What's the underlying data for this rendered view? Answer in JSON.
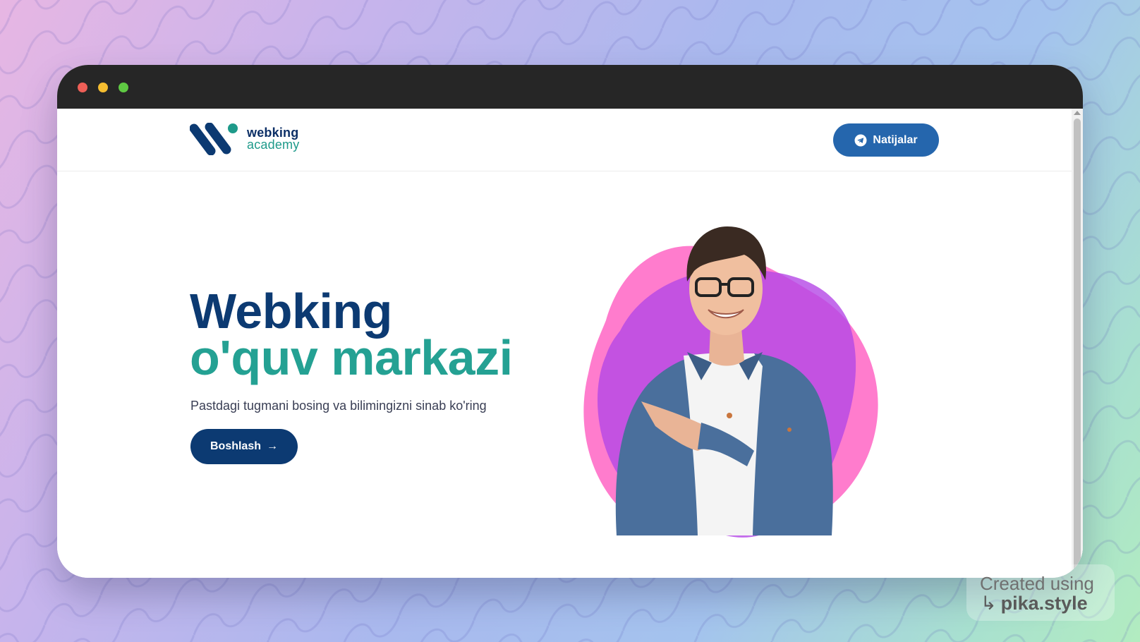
{
  "brand": {
    "logo_line1": "webking",
    "logo_line2": "academy",
    "primary_color": "#0c3a72",
    "accent_color": "#24a193",
    "button_color": "#2566ad"
  },
  "window": {
    "controls": [
      "close",
      "minimize",
      "maximize"
    ]
  },
  "header": {
    "results_button_label": "Natijalar",
    "results_button_icon": "telegram-icon"
  },
  "hero": {
    "title_line1": "Webking",
    "title_line2": "o'quv markazi",
    "subtitle": "Pastdagi tugmani bosing va bilimingizni sinab ko'ring",
    "start_button_label": "Boshlash",
    "start_button_icon": "arrow-right-icon"
  },
  "watermark": {
    "line1": "Created using",
    "line2": "pika.style",
    "icon": "return-arrow-icon"
  }
}
